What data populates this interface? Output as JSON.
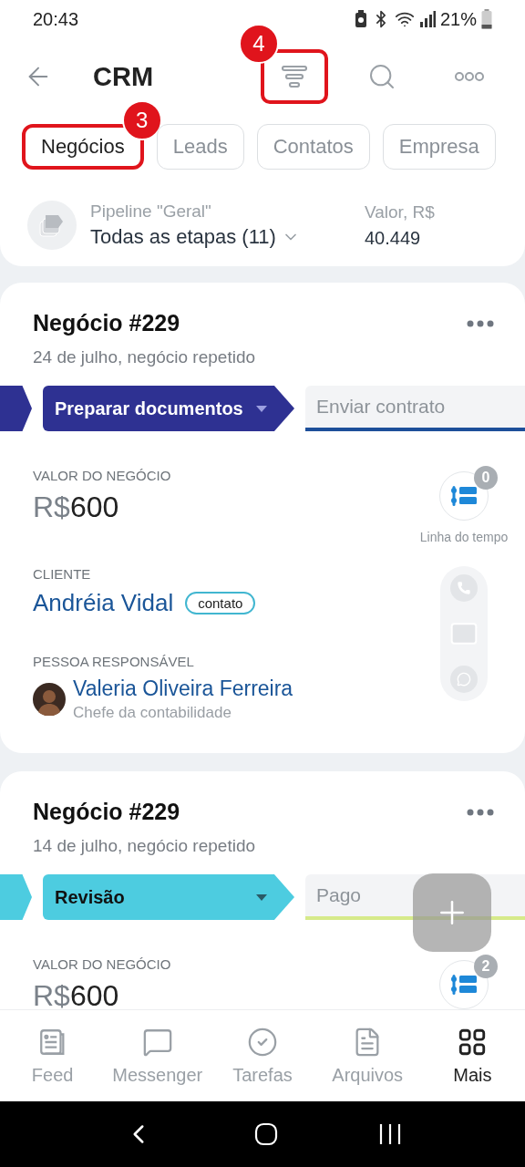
{
  "status_bar": {
    "time": "20:43",
    "battery": "21%"
  },
  "header": {
    "title": "CRM",
    "filter_callout": "4"
  },
  "tabs": [
    {
      "label": "Negócios",
      "selected": true,
      "callout": "3"
    },
    {
      "label": "Leads",
      "selected": false
    },
    {
      "label": "Contatos",
      "selected": false
    },
    {
      "label": "Empresa",
      "selected": false
    }
  ],
  "pipeline": {
    "label": "Pipeline \"Geral\"",
    "stages": "Todas as etapas (11)",
    "value_label": "Valor, R$",
    "value": "40.449"
  },
  "deals": [
    {
      "title": "Negócio #229",
      "subtitle": "24 de julho, negócio repetido",
      "stage": "Preparar documentos",
      "color": "#2e3192",
      "next_stage": {
        "label": "Enviar contrato",
        "color": "#1d4f9a"
      },
      "value_label": "VALOR DO NEGÓCIO",
      "currency": "R$",
      "amount": "600",
      "timeline_count": "0",
      "timeline_label": "Linha do tempo",
      "client_label": "CLIENTE",
      "client": "Andréia Vidal",
      "client_tag": "contato",
      "responsible_label": "PESSOA RESPONSÁVEL",
      "responsible": "Valeria Oliveira Ferreira",
      "responsible_role": "Chefe da contabilidade"
    },
    {
      "title": "Negócio #229",
      "subtitle": "14 de julho, negócio repetido",
      "stage": "Revisão",
      "color": "#4dcce0",
      "next_stage": {
        "label": "Pago",
        "color": "#d6ea8a"
      },
      "value_label": "VALOR DO NEGÓCIO",
      "currency": "R$",
      "amount": "600",
      "timeline_count": "2"
    }
  ],
  "nav": [
    {
      "label": "Feed",
      "kind": "feed",
      "selected": false
    },
    {
      "label": "Messenger",
      "kind": "messenger",
      "selected": false
    },
    {
      "label": "Tarefas",
      "kind": "tasks",
      "selected": false
    },
    {
      "label": "Arquivos",
      "kind": "files",
      "selected": false
    },
    {
      "label": "Mais",
      "kind": "more",
      "selected": true
    }
  ]
}
